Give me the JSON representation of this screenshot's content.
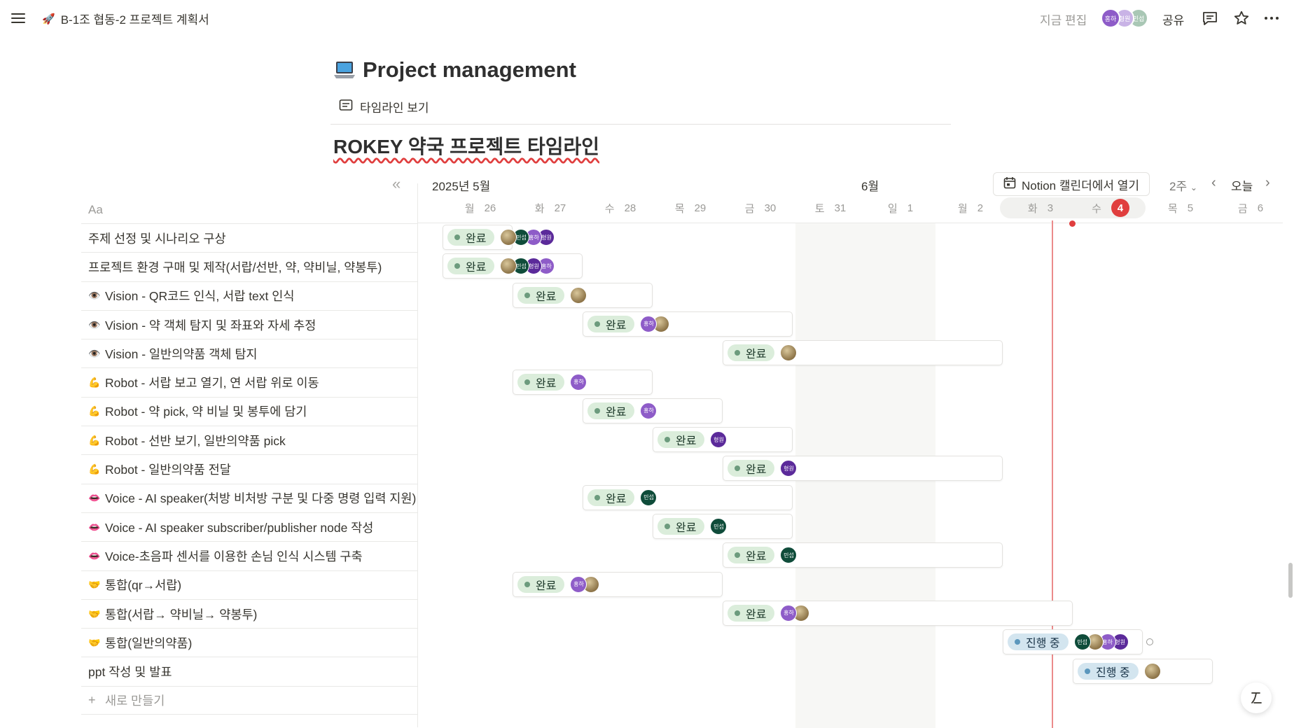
{
  "topbar": {
    "emoji": "🚀",
    "breadcrumb": "B-1조 협동-2 프로젝트 계획서",
    "edited": "지금 편집",
    "share": "공유",
    "avatars": [
      {
        "initial": "홍하",
        "color": "#8e5cc8"
      },
      {
        "initial": "형원",
        "color": "#c9b3e6"
      },
      {
        "initial": "민섭",
        "color": "#a9c7b5"
      }
    ]
  },
  "page": {
    "icon": "laptop-icon",
    "title": "Project management",
    "view_tab": "타임라인 보기",
    "timeline_title": "ROKEY 약국 프로젝트 타임라인"
  },
  "timeline": {
    "name_header": "Aa",
    "month_may": "2025년 5월",
    "month_jun": "6월",
    "open_calendar": "Notion 캘린더에서 열기",
    "zoom": "2주",
    "today": "오늘",
    "days": [
      {
        "dow": "월",
        "num": "26"
      },
      {
        "dow": "화",
        "num": "27"
      },
      {
        "dow": "수",
        "num": "28"
      },
      {
        "dow": "목",
        "num": "29"
      },
      {
        "dow": "금",
        "num": "30"
      },
      {
        "dow": "토",
        "num": "31"
      },
      {
        "dow": "일",
        "num": "1"
      },
      {
        "dow": "월",
        "num": "2"
      },
      {
        "dow": "화",
        "num": "3"
      },
      {
        "dow": "수",
        "num": "4",
        "today": true
      },
      {
        "dow": "목",
        "num": "5"
      },
      {
        "dow": "금",
        "num": "6"
      }
    ],
    "new_item": "새로 만들기"
  },
  "people": {
    "photo": {
      "label": "",
      "color": "#b8a27a"
    },
    "minseop": {
      "label": "민섭",
      "color": "#0f4c3a"
    },
    "hongha": {
      "label": "홍하",
      "color": "#8e5cc8"
    },
    "hyeongwon": {
      "label": "형원",
      "color": "#5b2a9a"
    }
  },
  "tasks": [
    {
      "icon": "",
      "name": "주제 선정 및 시나리오 구상",
      "start": 26,
      "end": 26,
      "status": "완료",
      "people": [
        "photo",
        "minseop",
        "hongha",
        "hyeongwon"
      ]
    },
    {
      "icon": "",
      "name": "프로젝트 환경 구매 및 제작(서랍/선반, 약, 약비닐, 약봉투)",
      "start": 26,
      "end": 27,
      "status": "완료",
      "people": [
        "photo",
        "minseop",
        "hyeongwon",
        "hongha"
      ]
    },
    {
      "icon": "👁️",
      "name": "Vision - QR코드 인식, 서랍 text 인식",
      "start": 27,
      "end": 28,
      "status": "완료",
      "people": [
        "photo"
      ]
    },
    {
      "icon": "👁️",
      "name": "Vision - 약 객체 탐지 및 좌표와 자세 추정",
      "start": 28,
      "end": 30,
      "status": "완료",
      "people": [
        "hongha",
        "photo"
      ]
    },
    {
      "icon": "👁️",
      "name": "Vision - 일반의약품 객체 탐지",
      "start": 30,
      "end": 33,
      "status": "완료",
      "people": [
        "photo"
      ]
    },
    {
      "icon": "💪",
      "name": "Robot - 서랍 보고 열기, 연 서랍 위로 이동",
      "start": 27,
      "end": 28,
      "status": "완료",
      "people": [
        "hongha"
      ]
    },
    {
      "icon": "💪",
      "name": "Robot - 약 pick, 약 비닐 및 봉투에 담기",
      "start": 28,
      "end": 29,
      "status": "완료",
      "people": [
        "hongha"
      ]
    },
    {
      "icon": "💪",
      "name": "Robot - 선반 보기, 일반의약품 pick",
      "start": 29,
      "end": 30,
      "status": "완료",
      "people": [
        "hyeongwon"
      ]
    },
    {
      "icon": "💪",
      "name": "Robot - 일반의약품 전달",
      "start": 30,
      "end": 33,
      "status": "완료",
      "people": [
        "hyeongwon"
      ]
    },
    {
      "icon": "👄",
      "name": "Voice - AI speaker(처방 비처방 구분 및 다중 명령 입력 지원)",
      "start": 28,
      "end": 30,
      "status": "완료",
      "people": [
        "minseop"
      ]
    },
    {
      "icon": "👄",
      "name": "Voice - AI speaker subscriber/publisher node 작성",
      "start": 29,
      "end": 30,
      "status": "완료",
      "people": [
        "minseop"
      ]
    },
    {
      "icon": "👄",
      "name": "Voice-초음파 센서를 이용한 손님 인식 시스템 구축",
      "start": 30,
      "end": 33,
      "status": "완료",
      "people": [
        "minseop"
      ]
    },
    {
      "icon": "🤝",
      "name": "통합(qr→서랍)",
      "start": 27,
      "end": 29,
      "status": "완료",
      "people": [
        "hongha",
        "photo"
      ]
    },
    {
      "icon": "🤝",
      "name": "통합(서랍→ 약비닐→ 약봉투)",
      "start": 30,
      "end": 34,
      "status": "완료",
      "people": [
        "hongha",
        "photo"
      ]
    },
    {
      "icon": "🤝",
      "name": "통합(일반의약품)",
      "start": 34,
      "end": 35,
      "status": "진행 중",
      "people": [
        "minseop",
        "photo",
        "hongha",
        "hyeongwon"
      ]
    },
    {
      "icon": "",
      "name": "ppt 작성 및 발표",
      "start": 35,
      "end": 36,
      "status": "진행 중",
      "people": [
        "photo"
      ]
    }
  ]
}
